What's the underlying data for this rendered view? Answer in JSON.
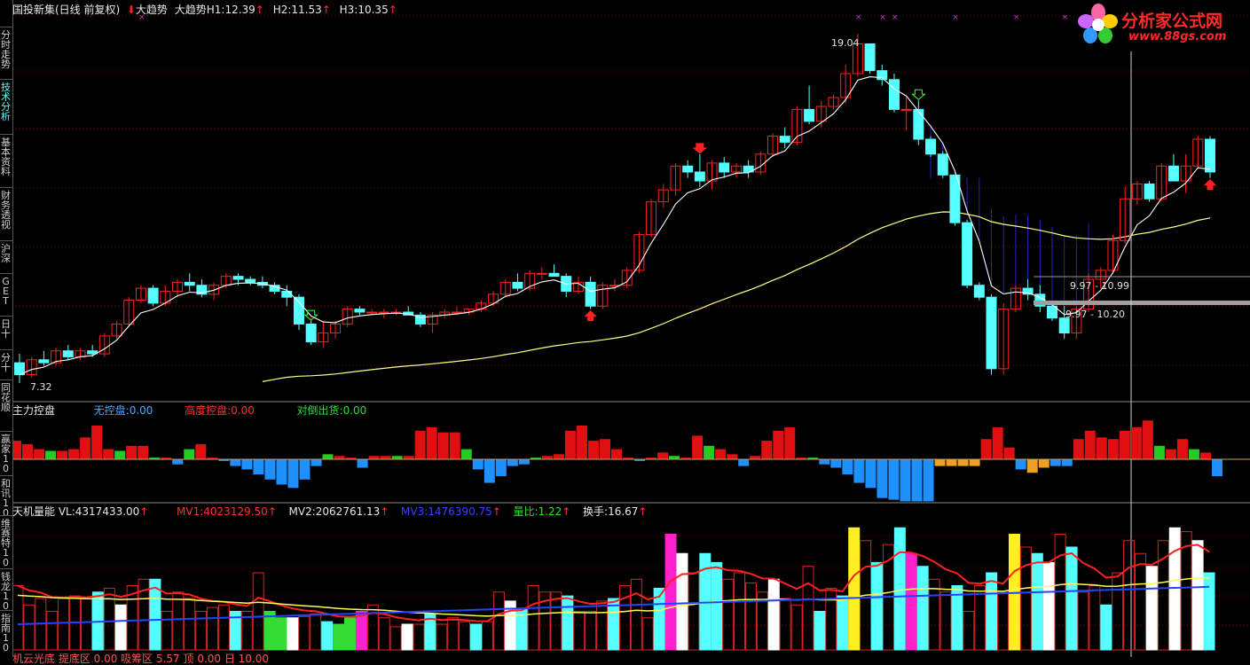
{
  "header1": {
    "name": "国投新集(日线 前复权)",
    "indicator_name": "大趋势",
    "indicator_label": "大趋势H1:",
    "h1": "12.39",
    "h2_label": "H2:",
    "h2": "11.53",
    "h3_label": "H3:",
    "h3": "10.35"
  },
  "header2": {
    "title": "主力控盘",
    "a_label": "无控盘:",
    "a": "0.00",
    "b_label": "高度控盘:",
    "b": "0.00",
    "c_label": "对倒出货:",
    "c": "0.00"
  },
  "header3": {
    "title": "天机量能",
    "vl_label": "VL:",
    "vl": "4317433.00",
    "mv1_label": "MV1:",
    "mv1": "4023129.50",
    "mv2_label": "MV2:",
    "mv2": "2062761.13",
    "mv3_label": "MV3:",
    "mv3": "1476390.75",
    "lb_label": "量比:",
    "lb": "1.22",
    "hs_label": "换手:",
    "hs": "16.67"
  },
  "footer_partial": "机云光底 提底区 0.00 吸筹区 5.57 顶 0.00 日 10.00",
  "price_labels": {
    "high": "19.04",
    "low": "7.32",
    "range1": "9.97 - 10.99",
    "range2": "9.97 - 10.20"
  },
  "sidebar": {
    "tabs": [
      {
        "label": "分时走势"
      },
      {
        "label": "技术分析"
      },
      {
        "label": "基本资料"
      },
      {
        "label": "财务透视"
      },
      {
        "label": "沪深"
      },
      {
        "label": "GET"
      },
      {
        "label": "日十"
      },
      {
        "label": "分十"
      },
      {
        "label": "同花顺"
      },
      {
        "label": "赢家10"
      },
      {
        "label": "和讯10"
      },
      {
        "label": "维赛特10"
      },
      {
        "label": "钱龙10"
      },
      {
        "label": "指南10"
      }
    ]
  },
  "brand": {
    "name": "分析家公式网",
    "url": "www.88gs.com"
  },
  "colors": {
    "bull": "#ff2020",
    "bear": "#55ffff",
    "ma_white": "#ffffff",
    "ma_yellow": "#ffff88",
    "blue_fill": "#2222cc",
    "vol_red_line": "#ff2020",
    "vol_yellow_line": "#ffff55",
    "vol_blue_line": "#2244ff"
  },
  "chart_data": [
    {
      "type": "candlestick",
      "title": "国投新集(日线 前复权)",
      "series": [
        {
          "name": "price",
          "ohlc": [
            [
              8.0,
              8.3,
              7.32,
              7.6
            ],
            [
              7.6,
              8.2,
              7.5,
              8.1
            ],
            [
              8.1,
              8.4,
              7.9,
              8.0
            ],
            [
              8.0,
              8.5,
              7.9,
              8.4
            ],
            [
              8.4,
              8.6,
              8.1,
              8.2
            ],
            [
              8.2,
              8.5,
              8.1,
              8.4
            ],
            [
              8.4,
              8.6,
              8.2,
              8.3
            ],
            [
              8.3,
              9.0,
              8.2,
              8.9
            ],
            [
              8.9,
              9.4,
              8.8,
              9.3
            ],
            [
              9.3,
              10.2,
              9.2,
              10.1
            ],
            [
              10.1,
              10.6,
              10.0,
              10.5
            ],
            [
              10.5,
              10.6,
              9.9,
              10.0
            ],
            [
              10.0,
              10.6,
              9.9,
              10.4
            ],
            [
              10.4,
              10.8,
              10.2,
              10.7
            ],
            [
              10.7,
              11.0,
              10.4,
              10.6
            ],
            [
              10.6,
              10.8,
              10.2,
              10.3
            ],
            [
              10.3,
              10.7,
              10.1,
              10.6
            ],
            [
              10.6,
              11.0,
              10.5,
              10.9
            ],
            [
              10.9,
              11.0,
              10.6,
              10.8
            ],
            [
              10.8,
              10.9,
              10.6,
              10.7
            ],
            [
              10.7,
              10.9,
              10.5,
              10.6
            ],
            [
              10.6,
              10.7,
              10.3,
              10.4
            ],
            [
              10.4,
              10.6,
              9.9,
              10.2
            ],
            [
              10.2,
              10.3,
              9.1,
              9.3
            ],
            [
              9.3,
              9.4,
              8.6,
              8.7
            ],
            [
              8.7,
              9.4,
              8.5,
              9.0
            ],
            [
              9.0,
              9.4,
              8.8,
              9.3
            ],
            [
              9.3,
              9.9,
              9.2,
              9.8
            ],
            [
              9.8,
              9.9,
              9.6,
              9.7
            ],
            [
              9.7,
              9.8,
              9.6,
              9.7
            ],
            [
              9.7,
              9.8,
              9.5,
              9.7
            ],
            [
              9.7,
              9.8,
              9.6,
              9.7
            ],
            [
              9.7,
              9.9,
              9.6,
              9.6
            ],
            [
              9.6,
              9.7,
              9.2,
              9.3
            ],
            [
              9.3,
              9.7,
              9.0,
              9.6
            ],
            [
              9.6,
              9.8,
              9.5,
              9.7
            ],
            [
              9.7,
              9.9,
              9.6,
              9.7
            ],
            [
              9.7,
              9.8,
              9.6,
              9.8
            ],
            [
              9.8,
              10.1,
              9.7,
              10.0
            ],
            [
              10.0,
              10.4,
              9.9,
              10.3
            ],
            [
              10.3,
              10.8,
              10.2,
              10.7
            ],
            [
              10.7,
              11.0,
              10.4,
              10.5
            ],
            [
              10.5,
              11.1,
              10.4,
              11.0
            ],
            [
              11.0,
              11.2,
              10.8,
              11.0
            ],
            [
              11.0,
              11.3,
              10.9,
              10.9
            ],
            [
              10.9,
              11.0,
              10.2,
              10.4
            ],
            [
              10.4,
              10.9,
              10.3,
              10.7
            ],
            [
              10.7,
              10.9,
              9.8,
              9.9
            ],
            [
              9.9,
              10.7,
              9.8,
              10.6
            ],
            [
              10.6,
              10.8,
              10.4,
              10.6
            ],
            [
              10.6,
              11.2,
              10.5,
              11.1
            ],
            [
              11.1,
              12.4,
              11.0,
              12.3
            ],
            [
              12.3,
              13.5,
              12.2,
              13.4
            ],
            [
              13.4,
              14.0,
              13.2,
              13.8
            ],
            [
              13.8,
              14.7,
              13.6,
              14.6
            ],
            [
              14.6,
              14.8,
              14.2,
              14.4
            ],
            [
              14.4,
              15.0,
              13.9,
              14.1
            ],
            [
              14.1,
              14.8,
              13.8,
              14.7
            ],
            [
              14.7,
              14.9,
              14.2,
              14.4
            ],
            [
              14.4,
              14.7,
              14.2,
              14.6
            ],
            [
              14.6,
              14.8,
              14.2,
              14.4
            ],
            [
              14.4,
              15.1,
              14.3,
              15.0
            ],
            [
              15.0,
              15.7,
              14.9,
              15.6
            ],
            [
              15.6,
              15.9,
              15.2,
              15.4
            ],
            [
              15.4,
              16.6,
              15.3,
              16.5
            ],
            [
              16.5,
              17.3,
              16.0,
              16.1
            ],
            [
              16.1,
              16.8,
              15.9,
              16.6
            ],
            [
              16.6,
              17.0,
              16.5,
              16.9
            ],
            [
              16.9,
              18.0,
              16.7,
              17.7
            ],
            [
              17.7,
              19.04,
              17.6,
              18.7
            ],
            [
              18.7,
              18.7,
              17.7,
              17.8
            ],
            [
              17.8,
              18.0,
              17.3,
              17.5
            ],
            [
              17.5,
              17.7,
              16.4,
              16.5
            ],
            [
              16.5,
              16.9,
              15.8,
              16.5
            ],
            [
              16.5,
              16.8,
              15.3,
              15.5
            ],
            [
              15.5,
              15.6,
              14.9,
              15.0
            ],
            [
              15.0,
              15.1,
              14.2,
              14.3
            ],
            [
              14.3,
              14.3,
              12.6,
              12.7
            ],
            [
              12.7,
              12.8,
              10.5,
              10.6
            ],
            [
              10.6,
              10.7,
              10.1,
              10.2
            ],
            [
              10.2,
              10.3,
              7.6,
              7.8
            ],
            [
              7.8,
              10.0,
              7.6,
              9.8
            ],
            [
              9.8,
              10.6,
              9.7,
              10.5
            ],
            [
              10.5,
              10.8,
              10.1,
              10.3
            ],
            [
              10.3,
              10.6,
              9.7,
              9.9
            ],
            [
              9.9,
              10.0,
              9.4,
              9.5
            ],
            [
              9.5,
              9.9,
              8.8,
              9.0
            ],
            [
              9.0,
              9.9,
              8.8,
              9.8
            ],
            [
              9.8,
              11.0,
              9.7,
              10.8
            ],
            [
              10.8,
              11.2,
              10.5,
              11.1
            ],
            [
              11.1,
              12.3,
              11.0,
              12.1
            ],
            [
              12.1,
              13.9,
              12.0,
              13.5
            ],
            [
              13.5,
              14.1,
              13.3,
              14.0
            ],
            [
              14.0,
              14.1,
              13.4,
              13.5
            ],
            [
              13.5,
              14.7,
              13.4,
              14.6
            ],
            [
              14.6,
              15.0,
              14.1,
              14.1
            ],
            [
              14.1,
              15.0,
              13.7,
              14.6
            ],
            [
              14.6,
              15.6,
              14.5,
              15.5
            ],
            [
              15.5,
              15.6,
              14.2,
              14.4
            ]
          ]
        }
      ]
    },
    {
      "type": "bar",
      "title": "主力控盘",
      "series": [
        {
          "name": "bias",
          "values": [
            0.55,
            0.45,
            0.3,
            0.25,
            0.25,
            0.3,
            0.65,
            1.0,
            0.3,
            0.25,
            0.4,
            0.4,
            0.05,
            0.05,
            -0.15,
            0.3,
            0.45,
            0.05,
            -0.05,
            -0.2,
            -0.3,
            -0.45,
            -0.6,
            -0.75,
            -0.85,
            -0.6,
            -0.2,
            0.15,
            0.1,
            0.05,
            -0.25,
            0.1,
            0.1,
            0.1,
            0.1,
            0.85,
            0.95,
            0.8,
            0.8,
            0.3,
            -0.3,
            -0.7,
            -0.5,
            -0.2,
            -0.15,
            0.05,
            0.1,
            0.15,
            0.85,
            1.0,
            0.55,
            0.6,
            0.3,
            0.05,
            -0.05,
            0.05,
            0.2,
            0.1,
            0.05,
            0.7,
            0.4,
            0.3,
            0.15,
            -0.2,
            0.1,
            0.55,
            0.85,
            0.95,
            0.05,
            0.05,
            -0.15,
            -0.25,
            -0.45,
            -0.7,
            -0.85,
            -1.15,
            -1.2,
            -1.25,
            -1.25,
            -1.25,
            -0.2,
            -0.2,
            -0.2,
            -0.2,
            0.6,
            0.95,
            0.35,
            -0.3,
            -0.4,
            -0.25,
            -0.2,
            -0.2,
            0.6,
            0.85,
            0.65,
            0.6,
            0.85,
            0.95,
            1.15,
            0.4,
            0.3,
            0.6,
            0.3,
            0.2,
            -0.5
          ]
        }
      ]
    },
    {
      "type": "bar",
      "title": "天机量能",
      "series": [
        {
          "name": "volume",
          "values": [
            0.5,
            0.35,
            0.4,
            0.3,
            0.4,
            0.42,
            0.4,
            0.45,
            0.48,
            0.35,
            0.5,
            0.55,
            0.55,
            0.3,
            0.45,
            0.4,
            0.3,
            0.33,
            0.35,
            0.3,
            0.3,
            0.6,
            0.3,
            0.25,
            0.25,
            0.26,
            0.28,
            0.22,
            0.2,
            0.25,
            0.3,
            0.35,
            0.25,
            0.18,
            0.2,
            0.2,
            0.28,
            0.2,
            0.25,
            0.22,
            0.2,
            0.22,
            0.45,
            0.38,
            0.32,
            0.5,
            0.45,
            0.45,
            0.42,
            0.3,
            0.3,
            0.38,
            0.4,
            0.5,
            0.55,
            0.25,
            0.48,
            0.9,
            0.75,
            0.6,
            0.75,
            0.68,
            0.55,
            0.6,
            0.52,
            0.45,
            0.55,
            0.4,
            0.35,
            0.65,
            0.3,
            0.48,
            0.42,
            0.95,
            0.85,
            0.68,
            0.82,
            0.95,
            0.75,
            0.65,
            0.55,
            0.45,
            0.5,
            0.3,
            0.5,
            0.6,
            0.45,
            0.9,
            0.8,
            0.75,
            0.68,
            0.9,
            0.8,
            0.45,
            0.5,
            0.35,
            0.6,
            0.85,
            0.75,
            0.65,
            0.85,
            0.95,
            0.92,
            0.85,
            0.6
          ]
        }
      ]
    }
  ]
}
